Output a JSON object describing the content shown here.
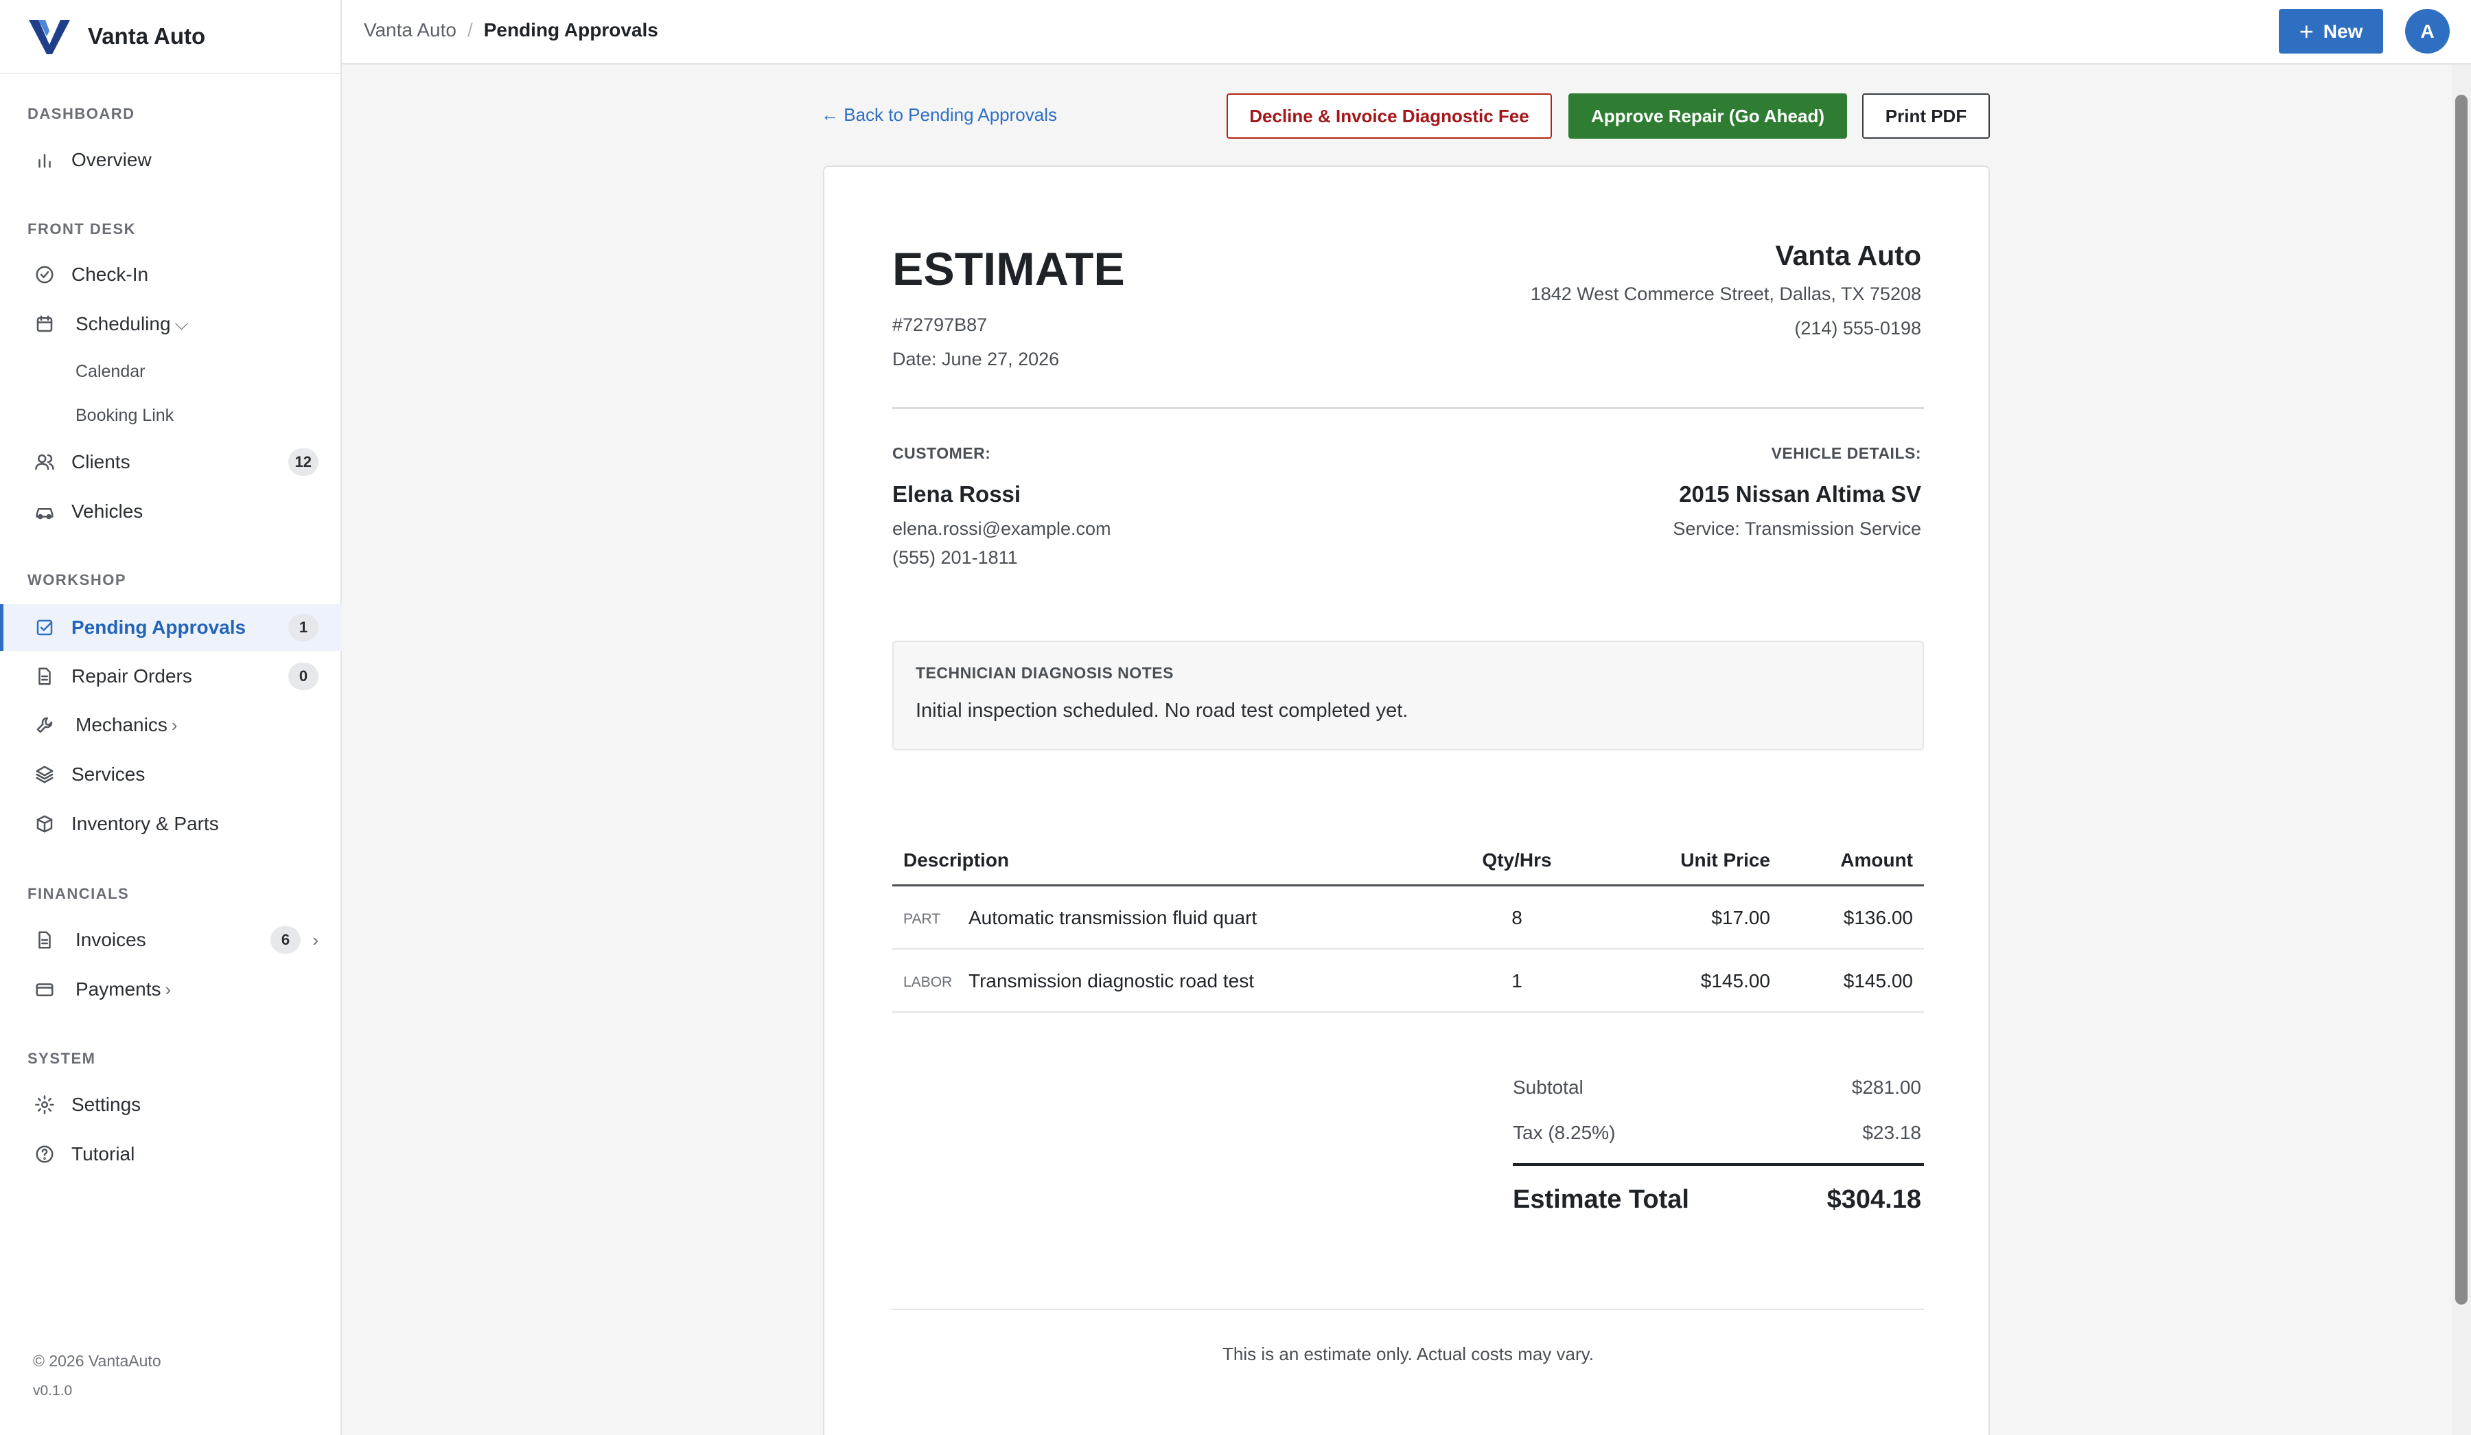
{
  "app": {
    "brand_name": "Vanta Auto",
    "accent_color": "#2f6fc2",
    "logo_icon": "v-logo-icon"
  },
  "sidebar": {
    "sections": {
      "dashboard": "DASHBOARD",
      "front_desk": "FRONT DESK",
      "workshop": "WORKSHOP",
      "financials": "FINANCIALS",
      "system": "SYSTEM"
    },
    "items": {
      "overview": {
        "label": "Overview",
        "icon": "bar-chart-icon"
      },
      "checkin": {
        "label": "Check-In",
        "icon": "check-circle-icon"
      },
      "scheduling": {
        "label": "Scheduling",
        "icon": "calendar-icon"
      },
      "calendar": {
        "label": "Calendar"
      },
      "booking_link": {
        "label": "Booking Link"
      },
      "clients": {
        "label": "Clients",
        "icon": "users-icon",
        "badge": "12"
      },
      "vehicles": {
        "label": "Vehicles",
        "icon": "car-icon"
      },
      "pending_approvals": {
        "label": "Pending Approvals",
        "icon": "checkbox-icon",
        "badge": "1"
      },
      "repair_orders": {
        "label": "Repair Orders",
        "icon": "document-icon",
        "badge": "0"
      },
      "mechanics": {
        "label": "Mechanics",
        "icon": "wrench-icon"
      },
      "services": {
        "label": "Services",
        "icon": "layers-icon"
      },
      "inventory": {
        "label": "Inventory & Parts",
        "icon": "box-icon"
      },
      "invoices": {
        "label": "Invoices",
        "icon": "document-icon",
        "badge": "6"
      },
      "payments": {
        "label": "Payments",
        "icon": "credit-card-icon"
      },
      "settings": {
        "label": "Settings",
        "icon": "gear-icon"
      },
      "tutorial": {
        "label": "Tutorial",
        "icon": "help-circle-icon"
      }
    },
    "footer": {
      "copyright": "© 2026 VantaAuto",
      "version": "v0.1.0"
    }
  },
  "topbar": {
    "breadcrumb": [
      "Vanta Auto",
      "Pending Approvals"
    ],
    "new_button": "New",
    "avatar_initial": "A"
  },
  "actions": {
    "back_link": "← Back to Pending Approvals",
    "decline": "Decline & Invoice Diagnostic Fee",
    "approve": "Approve Repair (Go Ahead)",
    "print": "Print PDF"
  },
  "estimate": {
    "title": "ESTIMATE",
    "number": "#72797B87",
    "date": "Date: June 27, 2026",
    "shop": {
      "name": "Vanta Auto",
      "address": "1842 West Commerce Street, Dallas, TX 75208",
      "phone": "(214) 555-0198"
    },
    "customer": {
      "label": "CUSTOMER:",
      "name": "Elena Rossi",
      "email": "elena.rossi@example.com",
      "phone": "(555) 201-1811"
    },
    "vehicle": {
      "label": "VEHICLE DETAILS:",
      "name": "2015 Nissan Altima SV",
      "service": "Service: Transmission Service"
    },
    "notes": {
      "label": "TECHNICIAN DIAGNOSIS NOTES",
      "text": "Initial inspection scheduled. No road test completed yet."
    },
    "table": {
      "headers": {
        "description": "Description",
        "qty": "Qty/Hrs",
        "unit": "Unit Price",
        "amount": "Amount"
      },
      "rows": [
        {
          "kind": "PART",
          "description": "Automatic transmission fluid quart",
          "qty": "8",
          "unit": "$17.00",
          "amount": "$136.00"
        },
        {
          "kind": "LABOR",
          "description": "Transmission diagnostic road test",
          "qty": "1",
          "unit": "$145.00",
          "amount": "$145.00"
        }
      ]
    },
    "totals": {
      "subtotal_label": "Subtotal",
      "subtotal": "$281.00",
      "tax_label": "Tax (8.25%)",
      "tax": "$23.18",
      "total_label": "Estimate Total",
      "total": "$304.18"
    },
    "disclaimer": "This is an estimate only. Actual costs may vary."
  }
}
